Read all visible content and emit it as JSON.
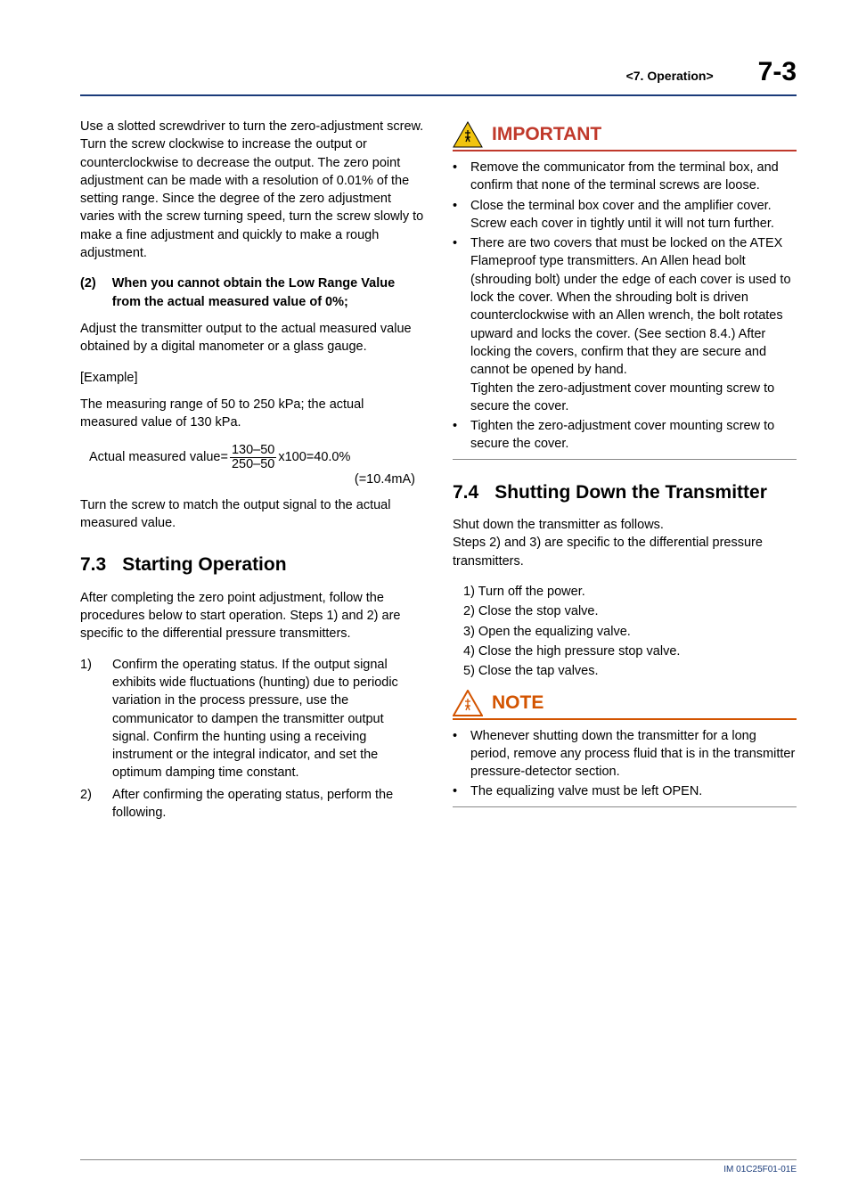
{
  "header": {
    "chapter": "<7.  Operation>",
    "page": "7-3"
  },
  "left": {
    "p1": "Use a slotted screwdriver to turn the zero-adjustment screw. Turn the screw clockwise to increase the output or counterclockwise to decrease the output. The zero point adjustment can be made with a resolution of 0.01% of the setting range. Since the degree of the zero adjustment varies with the screw turning speed, turn the screw slowly to make a fine adjustment and quickly to make a rough adjustment.",
    "sub2_num": "(2)",
    "sub2_txt": "When you cannot obtain the Low Range Value from the actual measured value of 0%;",
    "p2": "Adjust the transmitter output to the actual measured value obtained by a digital manometer or a glass gauge.",
    "example": "[Example]",
    "p3": "The measuring range of 50 to 250 kPa; the actual measured value of 130 kPa.",
    "formula_lead": "Actual measured value=",
    "formula_num": "130–50",
    "formula_den": "250–50",
    "formula_tail1": "x100=40.0%",
    "formula_tail2": "(=10.4mA)",
    "p4": "Turn the screw to match the output signal to the actual measured value.",
    "sec73_num": "7.3",
    "sec73_txt": "Starting Operation",
    "p5": "After completing the zero point adjustment, follow the procedures below to start operation. Steps 1) and 2) are specific to the differential pressure transmitters.",
    "steps": [
      {
        "n": "1)",
        "t": "Confirm the operating status. If the output signal exhibits wide fluctuations (hunting) due to periodic variation in the process pressure, use the communicator to dampen the transmitter output signal. Confirm the hunting using a receiving instrument or the integral indicator, and set the optimum damping time constant."
      },
      {
        "n": "2)",
        "t": "After confirming the operating status, perform the following."
      }
    ]
  },
  "right": {
    "important_label": "IMPORTANT",
    "important": [
      "Remove the communicator from the terminal box, and confirm that none of the terminal screws are loose.",
      "Close the terminal box cover and the amplifier cover. Screw each cover in tightly until it will not turn further.",
      "There are two covers that must be locked on the ATEX Flameproof type transmitters. An Allen head bolt (shrouding bolt) under the edge of each cover is used to lock the cover. When the shrouding bolt is driven counterclockwise with an Allen wrench, the bolt rotates upward and locks the cover. (See section 8.4.) After locking the covers, confirm that they are secure and cannot be opened by hand.\nTighten the zero-adjustment cover mounting screw to secure the cover.",
      "Tighten the zero-adjustment cover mounting screw to secure the cover."
    ],
    "sec74_num": "7.4",
    "sec74_txt": "Shutting Down the Transmitter",
    "p1": "Shut down the transmitter as follows.\nSteps 2) and 3) are specific to the differential pressure transmitters.",
    "list": [
      "1) Turn off the power.",
      "2) Close the stop valve.",
      "3) Open the equalizing valve.",
      "4) Close the high pressure stop valve.",
      "5) Close the tap valves."
    ],
    "note_label": "NOTE",
    "note": [
      "Whenever shutting down the transmitter for a long period, remove any process fluid that is in the transmitter pressure-detector section.",
      "The equalizing valve must be left OPEN."
    ]
  },
  "footer": {
    "doc": "IM 01C25F01-01E"
  }
}
